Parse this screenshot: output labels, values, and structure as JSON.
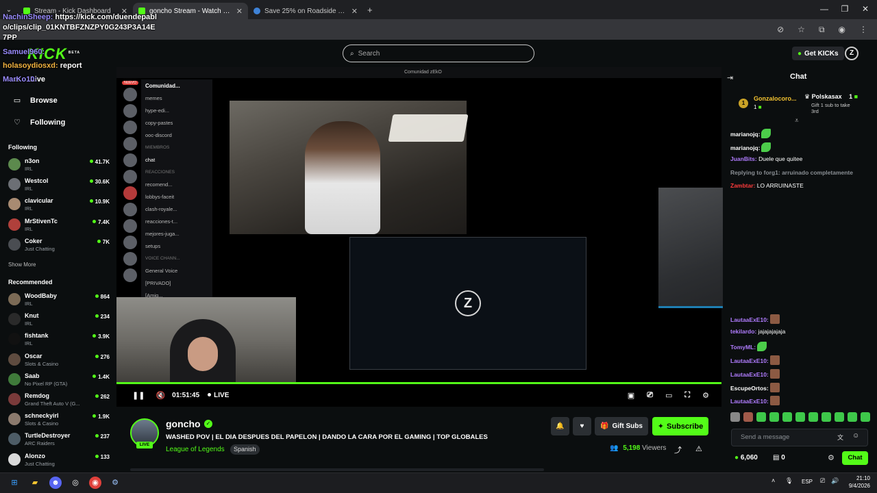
{
  "browser": {
    "tabs": [
      {
        "title": "Stream - Kick Dashboard"
      },
      {
        "title": "goncho Stream - Watch Live on Kick"
      },
      {
        "title": "Save 25% on Roadside Research"
      }
    ],
    "new_tab": "+",
    "close": "✕"
  },
  "overlay_chat": {
    "line1_user": "NachinSheep:",
    "line1_text": " https://kick.com/duendepabl",
    "line2": "o/clips/clip_01KNTBFZNZPY0G243P3A14E",
    "line3": "7PP",
    "line4_user": "Samuel960:",
    "line5_user": "holasoydiosxd:",
    "line5_text": " report",
    "line6_user": "MarKo10:"
  },
  "header": {
    "logo": "KICK",
    "beta": "BETA",
    "search_placeholder": "Search",
    "get_kicks": "Get KICKs",
    "profile_initial": "Z"
  },
  "sidebar": {
    "nav": [
      {
        "label": "Live",
        "icon": "home-icon"
      },
      {
        "label": "Browse",
        "icon": "compass-icon"
      },
      {
        "label": "Following",
        "icon": "heart-icon"
      }
    ],
    "following_title": "Following",
    "following": [
      {
        "name": "n3on",
        "cat": "IRL",
        "viewers": "41.7K",
        "color": "#5c8a4d"
      },
      {
        "name": "Westcol",
        "cat": "IRL",
        "viewers": "30.6K",
        "color": "#6c6f75"
      },
      {
        "name": "clavicular",
        "cat": "IRL",
        "viewers": "10.9K",
        "color": "#a88b72"
      },
      {
        "name": "MrStivenTc",
        "cat": "IRL",
        "viewers": "7.4K",
        "color": "#b0403b"
      },
      {
        "name": "Coker",
        "cat": "Just Chatting",
        "viewers": "7K",
        "color": "#4a4d52"
      }
    ],
    "show_more": "Show More",
    "recommended_title": "Recommended",
    "recommended": [
      {
        "name": "WoodBaby",
        "cat": "IRL",
        "viewers": "864",
        "color": "#7b6a55"
      },
      {
        "name": "Knut",
        "cat": "IRL",
        "viewers": "234",
        "color": "#2a2a2a"
      },
      {
        "name": "fishtank",
        "cat": "IRL",
        "viewers": "3.9K",
        "color": "#111"
      },
      {
        "name": "Oscar",
        "cat": "Slots & Casino",
        "viewers": "276",
        "color": "#5e4b3f"
      },
      {
        "name": "Saab",
        "cat": "No Pixel RP (GTA)",
        "viewers": "1.4K",
        "color": "#3f7a3a"
      },
      {
        "name": "Remdog",
        "cat": "Grand Theft Auto V (G...",
        "viewers": "262",
        "color": "#7a3a3a"
      },
      {
        "name": "schneckyirl",
        "cat": "Slots & Casino",
        "viewers": "1.9K",
        "color": "#8b7a6d"
      },
      {
        "name": "TurtleDestroyer",
        "cat": "ARC Raiders",
        "viewers": "237",
        "color": "#4d5c66"
      },
      {
        "name": "Alonzo",
        "cat": "Just Chatting",
        "viewers": "133",
        "color": "#d9d9d9"
      }
    ]
  },
  "discord": {
    "window_title": "Comunidad zEkO",
    "server": "Comunidad...",
    "badge_new": "NUEVO",
    "channels": [
      "memes",
      "hype-edi...",
      "copy-pastes",
      "ooc-discord"
    ],
    "members_header": "MIEMBROS",
    "chat_channel": "chat",
    "reactions_header": "REACCIONES",
    "channels2": [
      "recomend...",
      "lobbys-faceit",
      "clash-royale...",
      "reacciones-t...",
      "mejores-juga...",
      "setups"
    ],
    "voice_header": "VOICE CHANN...",
    "voice": [
      "General Voice",
      "[PRIVADO]",
      "[Amig..."
    ]
  },
  "player": {
    "time": "01:51:45",
    "live": "LIVE",
    "progress": 1.0
  },
  "stream": {
    "name": "goncho",
    "live_badge": "LIVE",
    "title": "WASHED POV | EL DIA DESPUES DEL PAPELON | DANDO LA CARA POR EL GAMING | TOP GLOBALES",
    "category": "League of Legends",
    "language": "Spanish",
    "gift_subs": "Gift Subs",
    "subscribe": "Subscribe",
    "viewers": "5,198",
    "viewers_label": "Viewers"
  },
  "chat": {
    "title": "Chat",
    "pinned_user": "Gonzalocoro...",
    "pinned_count": "1",
    "pinned_rank": "1",
    "gifter": "Polskasax",
    "gifter_count": "1",
    "gift_text": "Gift 1 sub to take",
    "gift_text2": "3rd",
    "messages": [
      {
        "user": "marianojq:",
        "text": "",
        "color": "#ffffff",
        "emote": "g"
      },
      {
        "user": "marianojq:",
        "text": "",
        "color": "#ffffff",
        "emote": "g"
      },
      {
        "user": "JuanBits:",
        "text": " Duele que quitee",
        "color": "#b07cff",
        "emote": ""
      },
      {
        "user": "Replying to forg1: arruinado completamente",
        "text": "",
        "color": "#8a8f94",
        "emote": ""
      },
      {
        "user": "Zambtar:",
        "text": " LO ARRUINASTE",
        "color": "#ff3b3b",
        "emote": ""
      }
    ],
    "messages_lower": [
      {
        "user": "LautaaExE10:",
        "text": "",
        "color": "#b07cff",
        "emote": "b"
      },
      {
        "user": "tekilardo:",
        "text": " jajajajajaja",
        "color": "#b07cff",
        "emote": ""
      },
      {
        "user": "TomyML:",
        "text": "",
        "color": "#b07cff",
        "emote": "g"
      },
      {
        "user": "LautaaExE10:",
        "text": "",
        "color": "#b07cff",
        "emote": "b"
      },
      {
        "user": "LautaaExE10:",
        "text": "",
        "color": "#b07cff",
        "emote": "b"
      },
      {
        "user": "EscupeOrtos:",
        "text": "",
        "color": "#ffffff",
        "emote": "b"
      },
      {
        "user": "LautaaExE10:",
        "text": "",
        "color": "#b07cff",
        "emote": "b"
      }
    ],
    "send_placeholder": "Send a message",
    "kicks_balance": "6,060",
    "points": "0",
    "chat_button": "Chat"
  },
  "taskbar": {
    "lang": "ESP",
    "time": "21:10",
    "date": "9/4/2026"
  }
}
